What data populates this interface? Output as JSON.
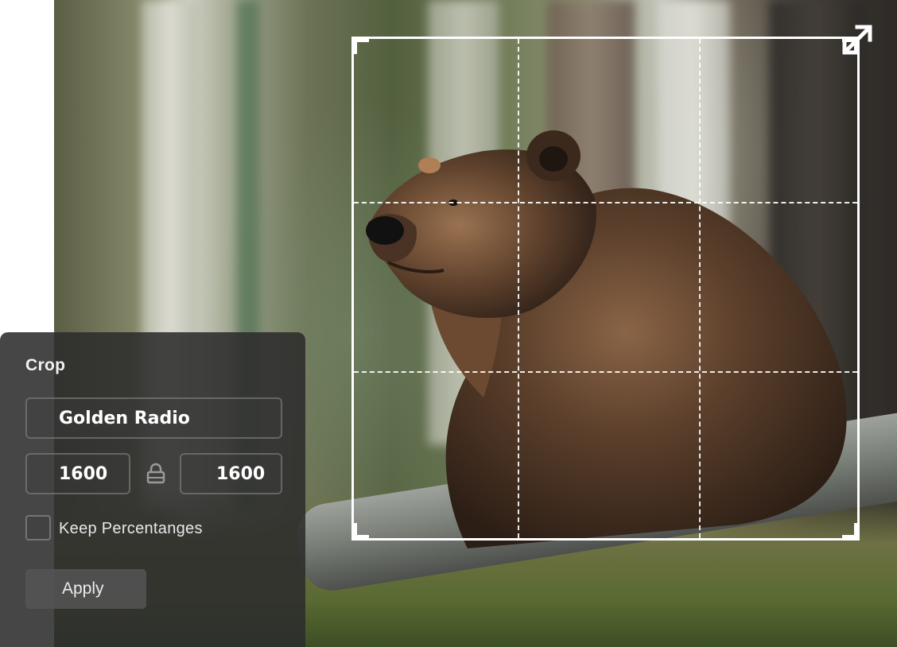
{
  "photo": {
    "subject": "bear-photo"
  },
  "crop_overlay": {
    "grid_lines": [
      "vertical-1",
      "vertical-2",
      "horizontal-1",
      "horizontal-2"
    ],
    "handle_icon": "diagonal-resize-arrow-icon"
  },
  "panel": {
    "title": "Crop",
    "preset_value": "Golden Radio",
    "width_value": "1600",
    "height_value": "1600",
    "lock_icon": "lock-icon",
    "keep_percentages_label": "Keep Percentanges",
    "keep_percentages_checked": false,
    "apply_label": "Apply"
  },
  "colors": {
    "panel_background": "#2c2c2c",
    "crop_border": "#ffffff",
    "field_border": "#8c8c8c",
    "apply_background": "#555555"
  }
}
